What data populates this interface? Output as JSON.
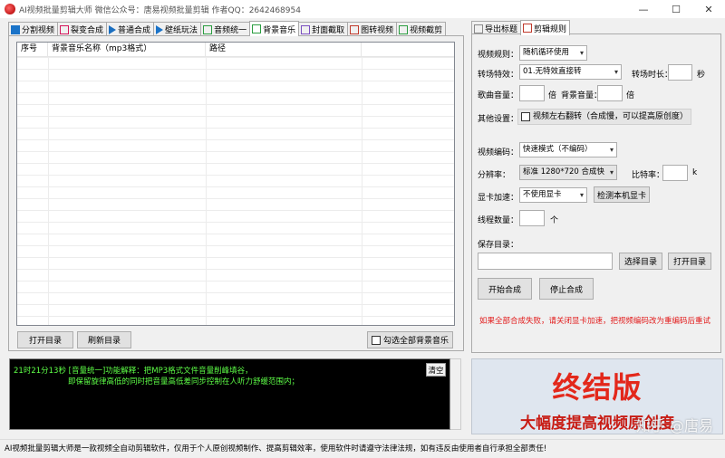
{
  "window": {
    "title": "AI视频批量剪辑大师  微信公众号：唐易视频批量剪辑  作者QQ：2642468954",
    "min": "—",
    "max": "☐",
    "close": "✕"
  },
  "tabs": [
    {
      "label": "分割视频",
      "color": "#1a73c8"
    },
    {
      "label": "裂变合成",
      "color": "#d4145a"
    },
    {
      "label": "普通合成",
      "color": "#1a6ec0"
    },
    {
      "label": "壁纸玩法",
      "color": "#1a73c8"
    },
    {
      "label": "音频统一",
      "color": "#2a9d40"
    },
    {
      "label": "背景音乐",
      "color": "#2a9d40"
    },
    {
      "label": "封面截取",
      "color": "#7a4fc0"
    },
    {
      "label": "图转视频",
      "color": "#c0392b"
    },
    {
      "label": "视频截剪",
      "color": "#2a9d40"
    }
  ],
  "listview": {
    "columns": [
      "序号",
      "背景音乐名称（mp3格式）",
      "路径"
    ]
  },
  "left_buttons": {
    "open_dir": "打开目录",
    "refresh_dir": "刷新目录",
    "select_all": "勾选全部背景音乐"
  },
  "log": {
    "line1": "21时21分13秒 [音量统一]功能解释：把MP3格式文件音量削峰填谷，",
    "line2": "即保留旋律高低的同时把音量高低差同步控制在人听力舒缓范围内；",
    "clear": "清空"
  },
  "right_tabs": [
    "导出标题",
    "剪辑规则"
  ],
  "settings": {
    "video_rule_label": "视频规则：",
    "video_rule_value": "随机循环使用",
    "transition_label": "转场特效：",
    "transition_value": "01.无特效直接转",
    "transition_dur_label": "转场时长：",
    "transition_dur_unit": "秒",
    "song_vol_label": "歌曲音量：",
    "song_vol_unit": "倍",
    "bg_vol_label": "背景音量：",
    "bg_vol_unit": "倍",
    "other_label": "其他设置：",
    "flip_label": "视频左右翻转（合成慢，可以提高原创度）",
    "encode_label": "视频编码：",
    "encode_value": "快速模式（不编码）",
    "resolution_label": "分辨率：",
    "resolution_value": "标准 1280*720 合成快",
    "bitrate_label": "比特率：",
    "bitrate_unit": "k",
    "gpu_label": "显卡加速：",
    "gpu_value": "不使用显卡",
    "detect_gpu": "检测本机显卡",
    "threads_label": "线程数量：",
    "threads_unit": "个",
    "save_dir_label": "保存目录：",
    "choose_dir": "选择目录",
    "open_dir": "打开目录",
    "start": "开始合成",
    "stop": "停止合成",
    "warning": "如果全部合成失败，请关闭显卡加速，把视频编码改为重编码后重试"
  },
  "banner": {
    "title": "终结版",
    "subtitle": "大幅度提高视频原创度",
    "watermark": "知乎 @唐易"
  },
  "status": "AI视频批量剪辑大师是一款视频全自动剪辑软件，仅用于个人原创视频制作、提高剪辑效率，使用软件时请遵守法律法规，如有违反由使用者自行承担全部责任!"
}
